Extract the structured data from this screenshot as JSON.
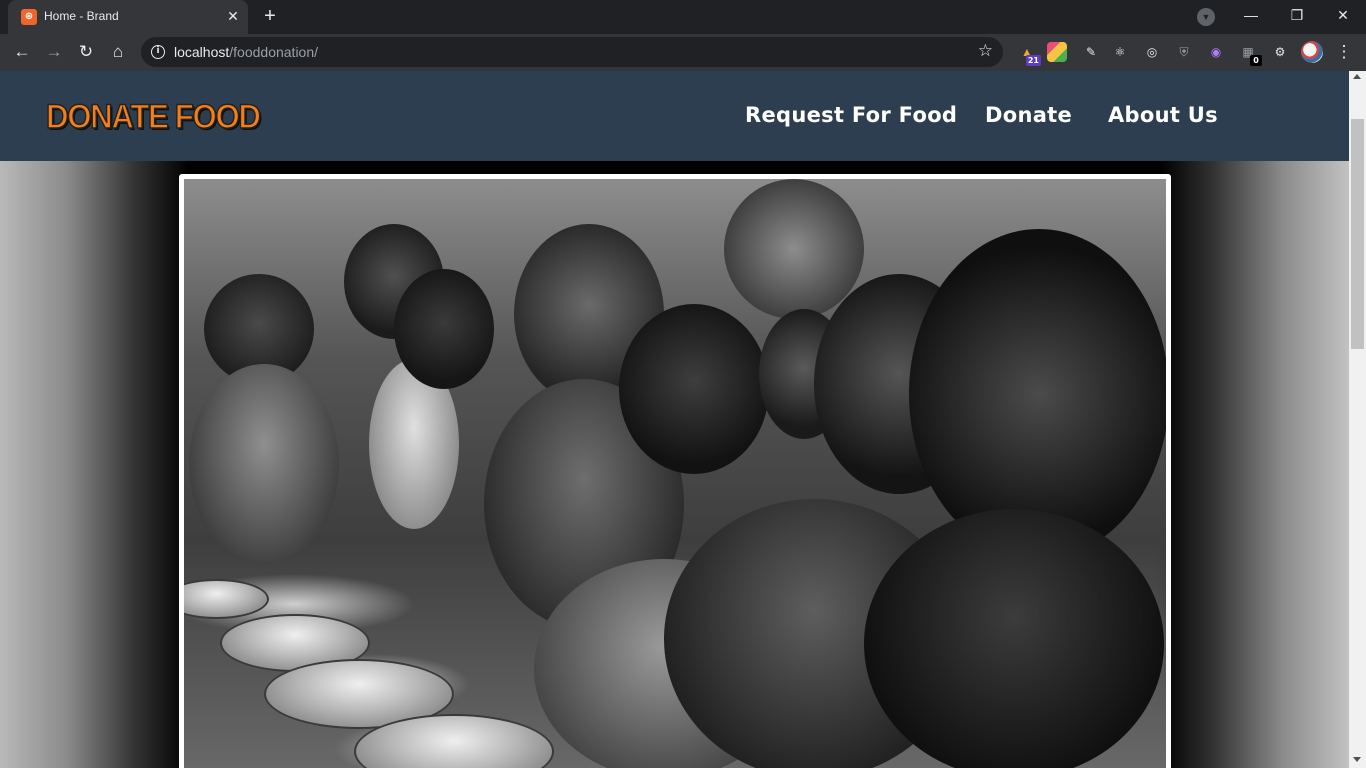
{
  "browser": {
    "tab": {
      "title": "Home - Brand",
      "favicon_icon": "xampp-icon",
      "favicon_color": "#f06529"
    },
    "url": {
      "host": "localhost",
      "path": "/fooddonation/"
    },
    "extension_badges": [
      "21",
      "0"
    ]
  },
  "site": {
    "logo_text": "DONATE FOOD",
    "logo_color": "#f47e17",
    "header_color": "#2c3e50",
    "nav": [
      "Request For Food",
      "Donate",
      "About Us"
    ]
  },
  "hero": {
    "image_icon": "hungry-children-photo",
    "style": "black-and-white photograph"
  }
}
